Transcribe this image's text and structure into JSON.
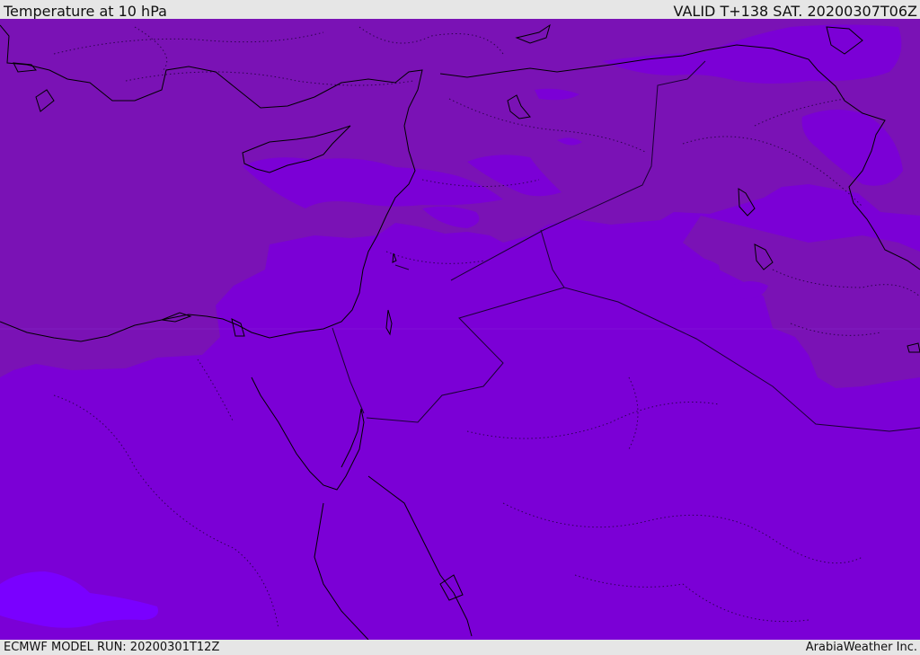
{
  "header": {
    "title": "Temperature at 10 hPa",
    "valid": "VALID T+138 SAT. 20200307T06Z"
  },
  "footer": {
    "model_run": "ECMWF MODEL RUN: 20200301T12Z",
    "credit": "ArabiaWeather Inc."
  },
  "map": {
    "colors": {
      "dark_band": "#7a12b5",
      "main_band": "#7b00d6",
      "light_band": "#7a00ff",
      "coastline": "#000000",
      "borders": "#1a0033"
    }
  }
}
